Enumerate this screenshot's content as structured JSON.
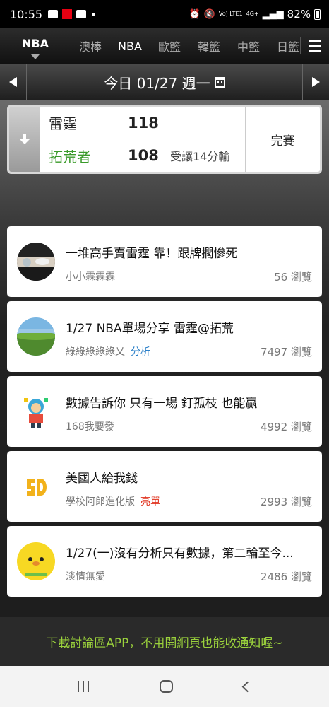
{
  "status_bar": {
    "time": "10:55",
    "net_top": "Vo) LTE1",
    "net_4g": "4G+",
    "battery": "82%"
  },
  "league_tabs": {
    "active": "NBA",
    "items": [
      "澳棒",
      "NBA",
      "歐籃",
      "韓籃",
      "中籃",
      "日籃"
    ]
  },
  "date_nav": {
    "label": "今日 01/27 週一"
  },
  "game": {
    "home": {
      "name": "雷霆",
      "score": "118"
    },
    "away": {
      "name": "拓荒者",
      "score": "108",
      "note": "受讓14分輸"
    },
    "status": "完賽",
    "colors": {
      "away_name": "#3a9a2a"
    }
  },
  "posts": [
    {
      "title": "一堆高手賣雷霆 靠！跟牌擱慘死",
      "author": "小小霖霖霖",
      "tag": "",
      "views": "56 瀏覽",
      "avatar": "photo"
    },
    {
      "title": "1/27 NBA單場分享 雷霆@拓荒",
      "author": "綠綠綠綠綠乂",
      "tag": "分析",
      "tag_color": "#2a7fc8",
      "views": "7497 瀏覽",
      "avatar": "landscape"
    },
    {
      "title": "數據告訴你 只有一場 釘孤枝 也能贏",
      "author": "168我要發",
      "tag": "",
      "views": "4992 瀏覽",
      "avatar": "cartoon"
    },
    {
      "title": "美國人給我錢",
      "author": "學校阿郎進化版",
      "tag": "亮單",
      "tag_color": "#e0321e",
      "views": "2993 瀏覽",
      "avatar": "sd-logo"
    },
    {
      "title": "1/27(一)沒有分析只有數據，第二輪至今...",
      "author": "淡情無愛",
      "tag": "",
      "views": "2486 瀏覽",
      "avatar": "chick"
    }
  ],
  "banner": {
    "text": "下載討論區APP，不用開網頁也能收通知喔~",
    "color": "#9bd23c"
  }
}
